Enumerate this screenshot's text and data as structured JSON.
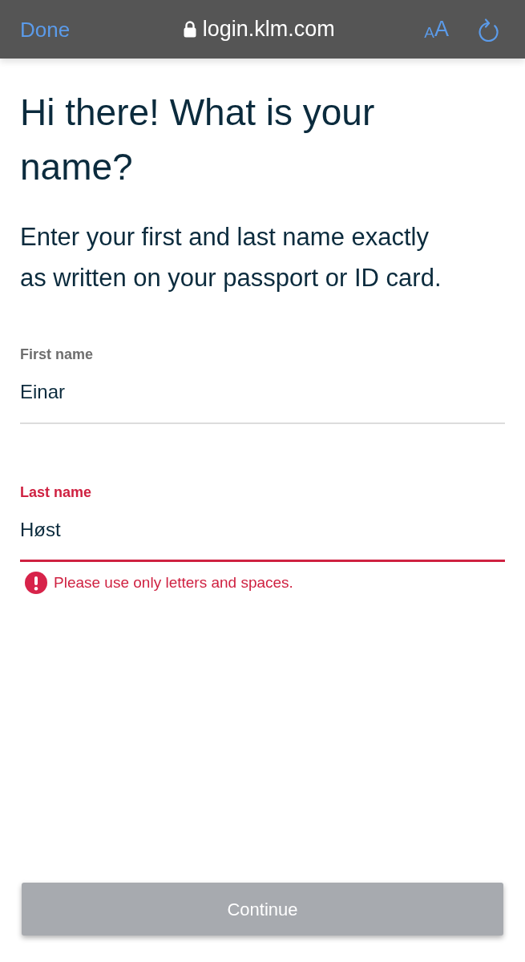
{
  "browser_bar": {
    "done": "Done",
    "secure": true,
    "url": "login.klm.com",
    "text_size": {
      "small": "A",
      "large": "A"
    }
  },
  "heading": "Hi there! What is your name?",
  "intro": "Enter your first and last name exactly as written on your passport or ID card.",
  "fields": [
    {
      "label": "First name",
      "value": "Einar",
      "invalid": false
    },
    {
      "label": "Last name",
      "value": "Høst",
      "invalid": true,
      "message": "Please use only letters and spaces."
    }
  ],
  "continue_button": {
    "label": "Continue",
    "disabled": true
  }
}
